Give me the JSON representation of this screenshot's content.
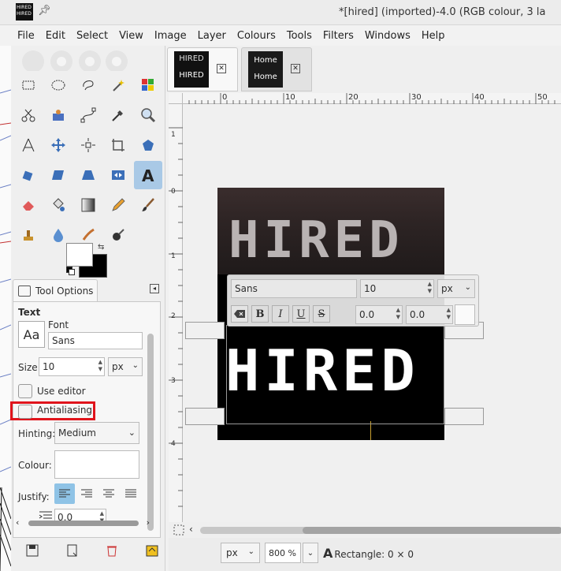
{
  "window": {
    "title": "*[hired] (imported)-4.0 (RGB colour, 3 la",
    "app_icon_text": "HIRED HIRED"
  },
  "menu": [
    "File",
    "Edit",
    "Select",
    "View",
    "Image",
    "Layer",
    "Colours",
    "Tools",
    "Filters",
    "Windows",
    "Help"
  ],
  "tools": [
    "rect-select-icon",
    "ellipse-select-icon",
    "free-select-icon",
    "fuzzy-select-icon",
    "by-colour-select-icon",
    "scissors-select-icon",
    "foreground-select-icon",
    "paths-icon",
    "color-picker-icon",
    "zoom-icon",
    "measure-icon",
    "move-icon",
    "align-icon",
    "crop-icon",
    "unified-transform-icon",
    "rotate-icon",
    "shear-icon",
    "perspective-icon",
    "flip-icon",
    "text-icon",
    "eraser-icon",
    "bucket-fill-icon",
    "gradient-icon",
    "pencil-icon",
    "paintbrush-icon",
    "clone-icon",
    "smudge-dropper-icon",
    "heal-icon",
    "dodge-burn-icon"
  ],
  "tool_options": {
    "tab_label": "Tool Options",
    "section_title": "Text",
    "font_label": "Font",
    "font_sample": "Aa",
    "font_value": "Sans",
    "size_label": "Size:",
    "size_value": "10",
    "size_unit": "px",
    "use_editor_label": "Use editor",
    "antialiasing_label": "Antialiasing",
    "hinting_label": "Hinting:",
    "hinting_value": "Medium",
    "colour_label": "Colour:",
    "justify_label": "Justify:",
    "indent_value": "0.0"
  },
  "image_tabs": [
    {
      "thumb_top": "HIRED",
      "thumb_bottom": "HIRED",
      "active": true
    },
    {
      "thumb_top": "Home",
      "thumb_bottom": "Home",
      "active": false
    }
  ],
  "ruler": {
    "h_labels": [
      "0",
      "10",
      "20",
      "30",
      "40",
      "50"
    ],
    "v_labels": [
      "1",
      "0",
      "1",
      "2",
      "3",
      "4"
    ]
  },
  "canvas": {
    "image_text_top": "HIRED",
    "image_text_bottom": "HIRED"
  },
  "text_toolbar": {
    "font": "Sans",
    "size": "10",
    "unit": "px",
    "baseline": "0.0",
    "kerning": "0.0",
    "bold": "B",
    "italic": "I",
    "underline": "U",
    "strike": "S"
  },
  "status": {
    "unit": "px",
    "zoom": "800 %",
    "tool_text": "Rectangle: 0 × 0",
    "tool_glyph": "A"
  }
}
